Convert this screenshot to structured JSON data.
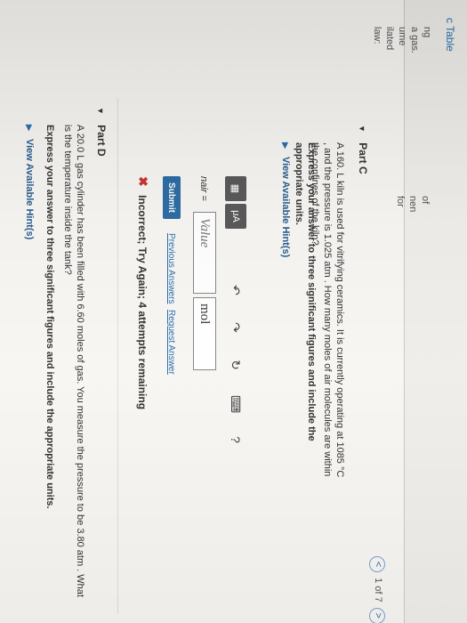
{
  "sidebar": {
    "link": "c Table",
    "text_lines": [
      "ng",
      "a gas.",
      "ume",
      "ilated",
      "law:"
    ],
    "text_lines_2": [
      "of",
      "nen",
      "for"
    ]
  },
  "pager": {
    "prev": "<",
    "label": "1 of 7",
    "next": ">"
  },
  "partC": {
    "title": "Part C",
    "question": "A 160. L kiln is used for vitrifying ceramics. It is currently operating at 1085 °C , and the pressure is 1.025 atm . How many moles of air molecules are within the confines of the kiln?",
    "instruction": "Express your answer to three significant figures and include the appropriate units.",
    "hints": "View Available Hint(s)",
    "toolbar": {
      "template_btn": "▦",
      "mu_btn": "μA",
      "undo": "↶",
      "redo": "↷",
      "reset": "↻",
      "keyboard": "⌨",
      "help": "?"
    },
    "var_label": "nair =",
    "value_placeholder": "Value",
    "unit_value": "mol",
    "submit": "Submit",
    "previous_answers": "Previous Answers",
    "request_answer": "Request Answer",
    "feedback_mark": "✖",
    "feedback": "Incorrect; Try Again; 4 attempts remaining"
  },
  "partD": {
    "title": "Part D",
    "question": "A 20.0 L gas cylinder has been filled with 6.60 moles of gas. You measure the pressure to be 3.80 atm . What is the temperature inside the tank?",
    "instruction": "Express your answer to three significant figures and include the appropriate units.",
    "hints": "View Available Hint(s)"
  }
}
